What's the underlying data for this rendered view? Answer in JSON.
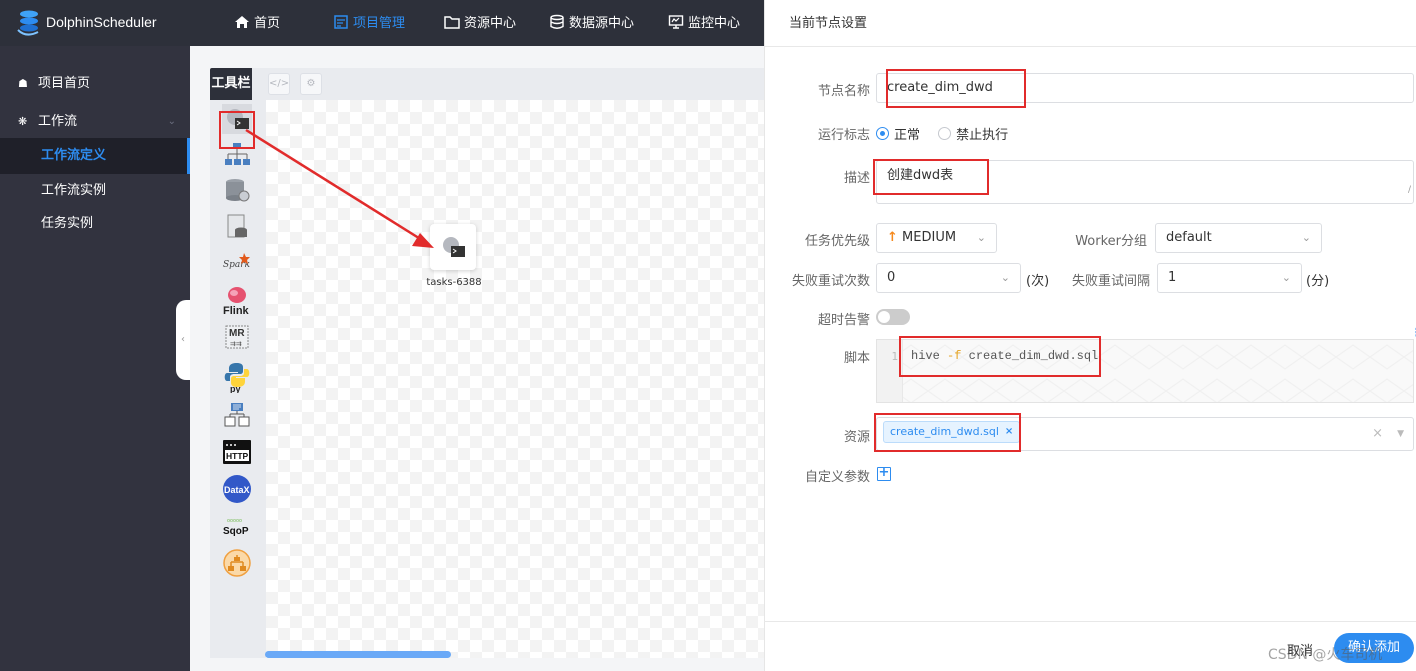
{
  "topnav": {
    "brand": "DolphinScheduler",
    "items": [
      {
        "label": "首页",
        "icon": "home-icon"
      },
      {
        "label": "项目管理",
        "icon": "project-icon",
        "active": true
      },
      {
        "label": "资源中心",
        "icon": "folder-icon"
      },
      {
        "label": "数据源中心",
        "icon": "database-icon"
      },
      {
        "label": "监控中心",
        "icon": "monitor-icon"
      }
    ]
  },
  "sidebar": {
    "items": [
      {
        "label": "项目首页",
        "icon": "home-icon"
      },
      {
        "label": "工作流",
        "icon": "gear-icon",
        "expanded": true
      },
      {
        "label": "工作流定义",
        "active": true
      },
      {
        "label": "工作流实例"
      },
      {
        "label": "任务实例"
      }
    ]
  },
  "canvas": {
    "toolbar_label": "工具栏",
    "task_types": [
      "shell",
      "sub-process",
      "procedure",
      "sql",
      "spark",
      "flink",
      "mr",
      "python",
      "dependent",
      "http",
      "datax",
      "sqoop",
      "conditions"
    ],
    "node": {
      "label": "tasks-6388"
    }
  },
  "drawer": {
    "title": "当前节点设置",
    "fields": {
      "node_name_label": "节点名称",
      "node_name_value": "create_dim_dwd",
      "run_flag_label": "运行标志",
      "run_flag_normal": "正常",
      "run_flag_forbidden": "禁止执行",
      "desc_label": "描述",
      "desc_value": "创建dwd表",
      "priority_label": "任务优先级",
      "priority_value": "MEDIUM",
      "worker_group_label": "Worker分组",
      "worker_group_value": "default",
      "retry_times_label": "失败重试次数",
      "retry_times_value": "0",
      "retry_times_unit": "(次)",
      "retry_interval_label": "失败重试间隔",
      "retry_interval_value": "1",
      "retry_interval_unit": "(分)",
      "timeout_label": "超时告警",
      "script_label": "脚本",
      "script_line_no": "1",
      "script_code_cmd": "hive ",
      "script_code_flag": "-f",
      "script_code_arg": " create_dim_dwd.sql",
      "resource_label": "资源",
      "resource_tag": "create_dim_dwd.sql",
      "custom_params_label": "自定义参数"
    },
    "footer": {
      "cancel": "取消",
      "confirm": "确认添加"
    }
  },
  "watermark": "CSDN @火车司机",
  "colors": {
    "accent": "#2d8cf0",
    "nav_bg": "#2d303a",
    "sidebar_bg": "#32333f",
    "annotation": "#e12b2b",
    "priority_arrow": "#f5891d"
  }
}
